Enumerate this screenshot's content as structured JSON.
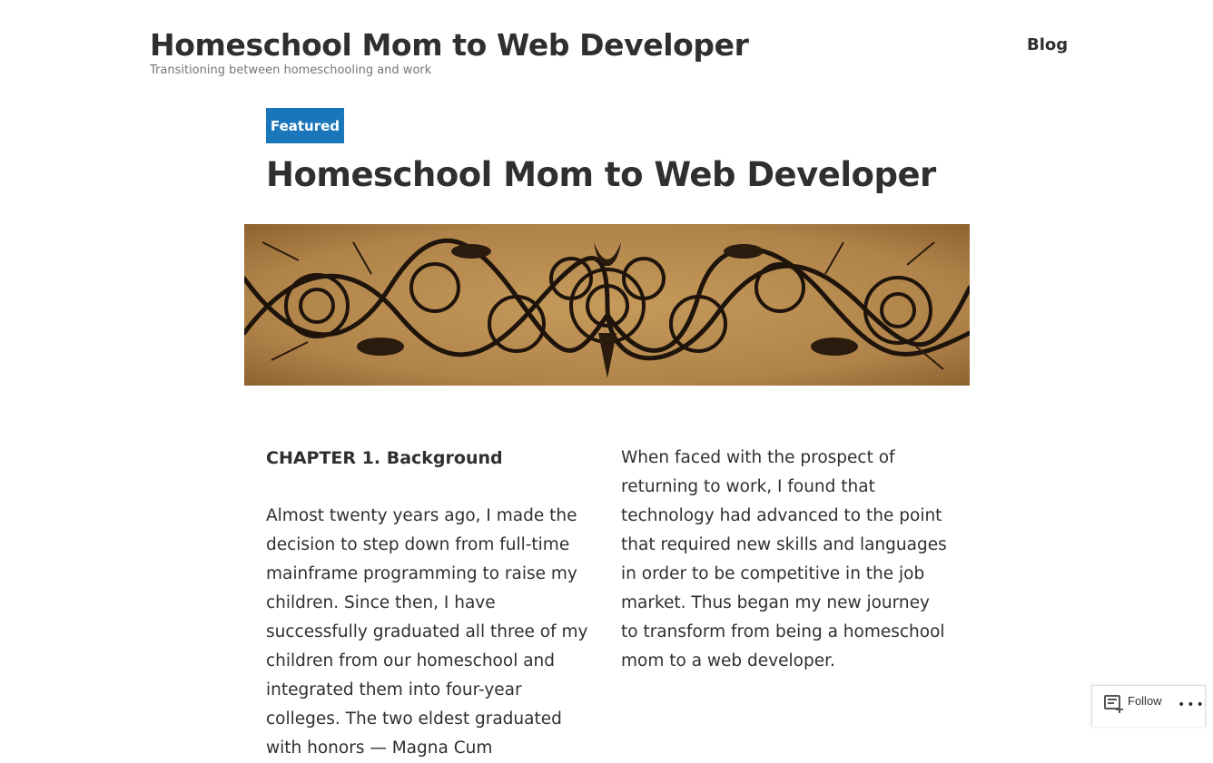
{
  "site": {
    "title": "Homeschool Mom to Web Developer",
    "tagline": "Transitioning between homeschooling and work"
  },
  "nav": {
    "items": [
      {
        "label": "Blog"
      }
    ]
  },
  "post": {
    "badge": "Featured",
    "title": "Homeschool Mom to Web Developer",
    "banner_image": "ornamental-scrollwork-banner",
    "chapter_heading": "CHAPTER 1. Background",
    "left_paragraph": "Almost twenty years ago, I made the decision to step down from full-time mainframe programming to raise my children. Since then, I have successfully graduated all three of my children from our homeschool and integrated them into four-year colleges. The two eldest graduated with honors — Magna Cum",
    "right_paragraph": "When faced with the prospect of returning to work, I found that technology had advanced to the point that required new skills and languages in order to be competitive in the job market. Thus began my new journey to transform from being a homeschool mom to a web developer."
  },
  "follow_widget": {
    "label": "Follow",
    "icon": "follow-reader-icon",
    "more_icon": "ellipsis-icon"
  },
  "colors": {
    "accent": "#1a76ba",
    "text": "#2f2f2f",
    "muted": "#767676",
    "banner_parchment": "#b48a4e"
  }
}
